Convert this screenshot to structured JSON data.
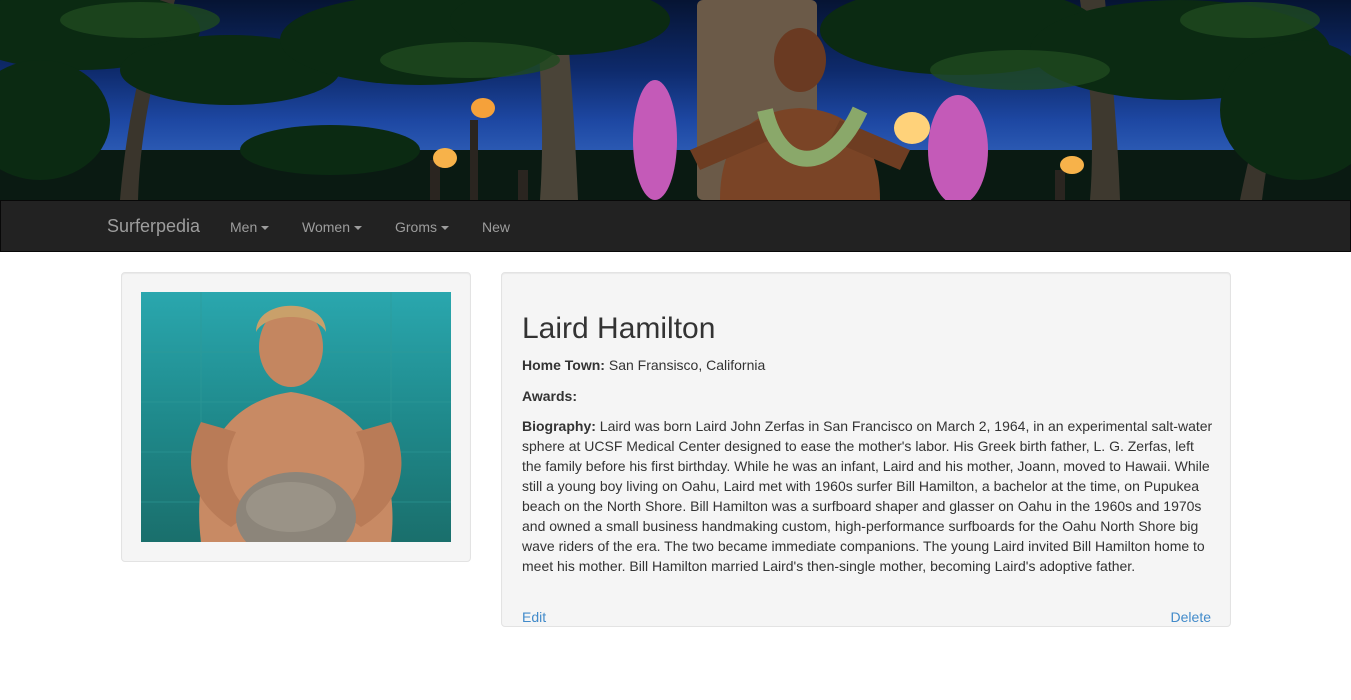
{
  "hero": {
    "image": "surfer-statue-banner"
  },
  "navbar": {
    "brand": "Surferpedia",
    "items": [
      {
        "label": "Men",
        "dropdown": true
      },
      {
        "label": "Women",
        "dropdown": true
      },
      {
        "label": "Groms",
        "dropdown": true
      },
      {
        "label": "New",
        "dropdown": false
      }
    ]
  },
  "profile": {
    "photo": "surfer-portrait",
    "name": "Laird Hamilton",
    "hometown_label": "Home Town:",
    "hometown": "San Fransisco, California",
    "awards_label": "Awards:",
    "awards": "",
    "biography_label": "Biography:",
    "biography": "Laird was born Laird John Zerfas in San Francisco on March 2, 1964, in an experimental salt-water sphere at UCSF Medical Center designed to ease the mother's labor. His Greek birth father, L. G. Zerfas, left the family before his first birthday. While he was an infant, Laird and his mother, Joann, moved to Hawaii. While still a young boy living on Oahu, Laird met with 1960s surfer Bill Hamilton, a bachelor at the time, on Pupukea beach on the North Shore. Bill Hamilton was a surfboard shaper and glasser on Oahu in the 1960s and 1970s and owned a small business handmaking custom, high-performance surfboards for the Oahu North Shore big wave riders of the era. The two became immediate companions. The young Laird invited Bill Hamilton home to meet his mother. Bill Hamilton married Laird's then-single mother, becoming Laird's adoptive father."
  },
  "actions": {
    "edit": "Edit",
    "delete": "Delete"
  },
  "colors": {
    "navbar": "#222222",
    "link": "#428bca",
    "well": "#f5f5f5"
  }
}
